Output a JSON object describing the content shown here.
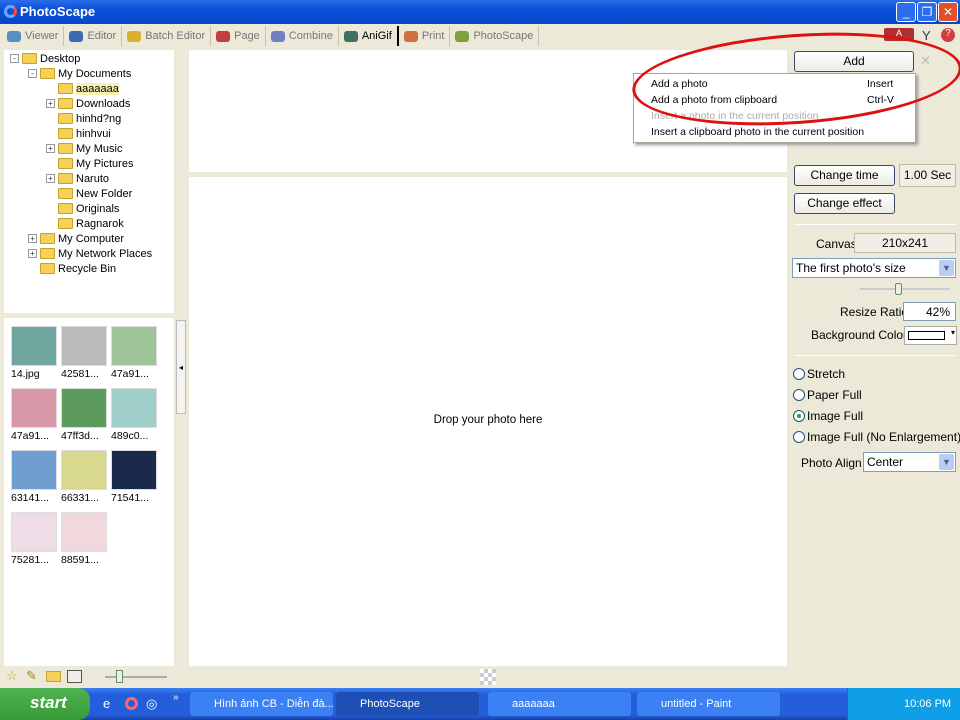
{
  "window": {
    "title": "PhotoScape"
  },
  "tabs": [
    {
      "label": "Viewer",
      "color": "#5a8fc0"
    },
    {
      "label": "Editor",
      "color": "#3a6ab0"
    },
    {
      "label": "Batch Editor",
      "color": "#d8b030"
    },
    {
      "label": "Page",
      "color": "#c04040"
    },
    {
      "label": "Combine",
      "color": "#7080c0"
    },
    {
      "label": "AniGif",
      "color": "#407060",
      "active": true
    },
    {
      "label": "Print",
      "color": "#d07040"
    },
    {
      "label": "PhotoScape",
      "color": "#80a040"
    }
  ],
  "tree": [
    {
      "label": "Desktop",
      "level": 0,
      "exp": "-"
    },
    {
      "label": "My Documents",
      "level": 1,
      "exp": "-"
    },
    {
      "label": "aaaaaaa",
      "level": 2,
      "selected": true
    },
    {
      "label": "Downloads",
      "level": 2,
      "exp": "+"
    },
    {
      "label": "hinhd?ng",
      "level": 2
    },
    {
      "label": "hinhvui",
      "level": 2
    },
    {
      "label": "My Music",
      "level": 2,
      "exp": "+"
    },
    {
      "label": "My Pictures",
      "level": 2
    },
    {
      "label": "Naruto",
      "level": 2,
      "exp": "+"
    },
    {
      "label": "New Folder",
      "level": 2
    },
    {
      "label": "Originals",
      "level": 2
    },
    {
      "label": "Ragnarok",
      "level": 2
    },
    {
      "label": "My Computer",
      "level": 1,
      "exp": "+"
    },
    {
      "label": "My Network Places",
      "level": 1,
      "exp": "+"
    },
    {
      "label": "Recycle Bin",
      "level": 1
    }
  ],
  "thumbnails": [
    {
      "label": "14.jpg",
      "color": "#6fa7a0"
    },
    {
      "label": "42581...",
      "color": "#bbbbbb"
    },
    {
      "label": "47a91...",
      "color": "#9fc49a"
    },
    {
      "label": "47a91...",
      "color": "#d998a8"
    },
    {
      "label": "47ff3d...",
      "color": "#5c9a5c"
    },
    {
      "label": "489c0...",
      "color": "#9fcfc8"
    },
    {
      "label": "63141...",
      "color": "#6f9fd0"
    },
    {
      "label": "66331...",
      "color": "#d8d88f"
    },
    {
      "label": "71541...",
      "color": "#1a2a4a"
    },
    {
      "label": "75281...",
      "color": "#eedde6"
    },
    {
      "label": "88591...",
      "color": "#f0d8dc"
    }
  ],
  "main": {
    "drop_text": "Drop your photo here"
  },
  "add_menu": {
    "button": "Add",
    "items": [
      {
        "label": "Add a photo",
        "shortcut": "Insert",
        "enabled": true
      },
      {
        "label": "Add a photo from clipboard",
        "shortcut": "Ctrl-V",
        "enabled": true
      },
      {
        "label": "Insert a photo in the current position",
        "shortcut": "",
        "enabled": false
      },
      {
        "label": "Insert a clipboard photo in the current position",
        "shortcut": "",
        "enabled": true
      }
    ]
  },
  "right": {
    "change_time": "Change time",
    "time_value": "1.00 Sec",
    "change_effect": "Change effect",
    "canvas_label": "Canvas",
    "canvas_value": "210x241",
    "size_select": "The first photo's size",
    "slider_percent": 42,
    "resize_label": "Resize Ratio",
    "resize_value": "42%",
    "bg_label": "Background Color",
    "bg_color": "#ffffff",
    "radios": [
      {
        "label": "Stretch",
        "checked": false
      },
      {
        "label": "Paper Full",
        "checked": false
      },
      {
        "label": "Image Full",
        "checked": true
      },
      {
        "label": "Image Full (No Enlargement)",
        "checked": false
      }
    ],
    "align_label": "Photo Align",
    "align_value": "Center"
  },
  "taskbar": {
    "start": "start",
    "tasks": [
      {
        "label": "Hình ảnh CB - Diễn đà..."
      },
      {
        "label": "PhotoScape",
        "active": true
      },
      {
        "label": "aaaaaaa"
      },
      {
        "label": "untitled - Paint"
      }
    ],
    "clock": "10:06 PM"
  }
}
